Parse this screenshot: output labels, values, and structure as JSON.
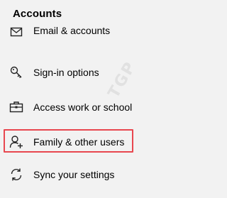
{
  "section": {
    "title": "Accounts"
  },
  "nav": {
    "items": [
      {
        "label": "Email & accounts",
        "icon": "mail-icon"
      },
      {
        "label": "Sign-in options",
        "icon": "key-icon"
      },
      {
        "label": "Access work or school",
        "icon": "briefcase-icon"
      },
      {
        "label": "Family & other users",
        "icon": "person-add-icon"
      },
      {
        "label": "Sync your settings",
        "icon": "sync-icon"
      }
    ]
  },
  "watermark": {
    "text": "TGP"
  },
  "colors": {
    "background": "#f2f2f2",
    "highlight": "#e8474f"
  }
}
